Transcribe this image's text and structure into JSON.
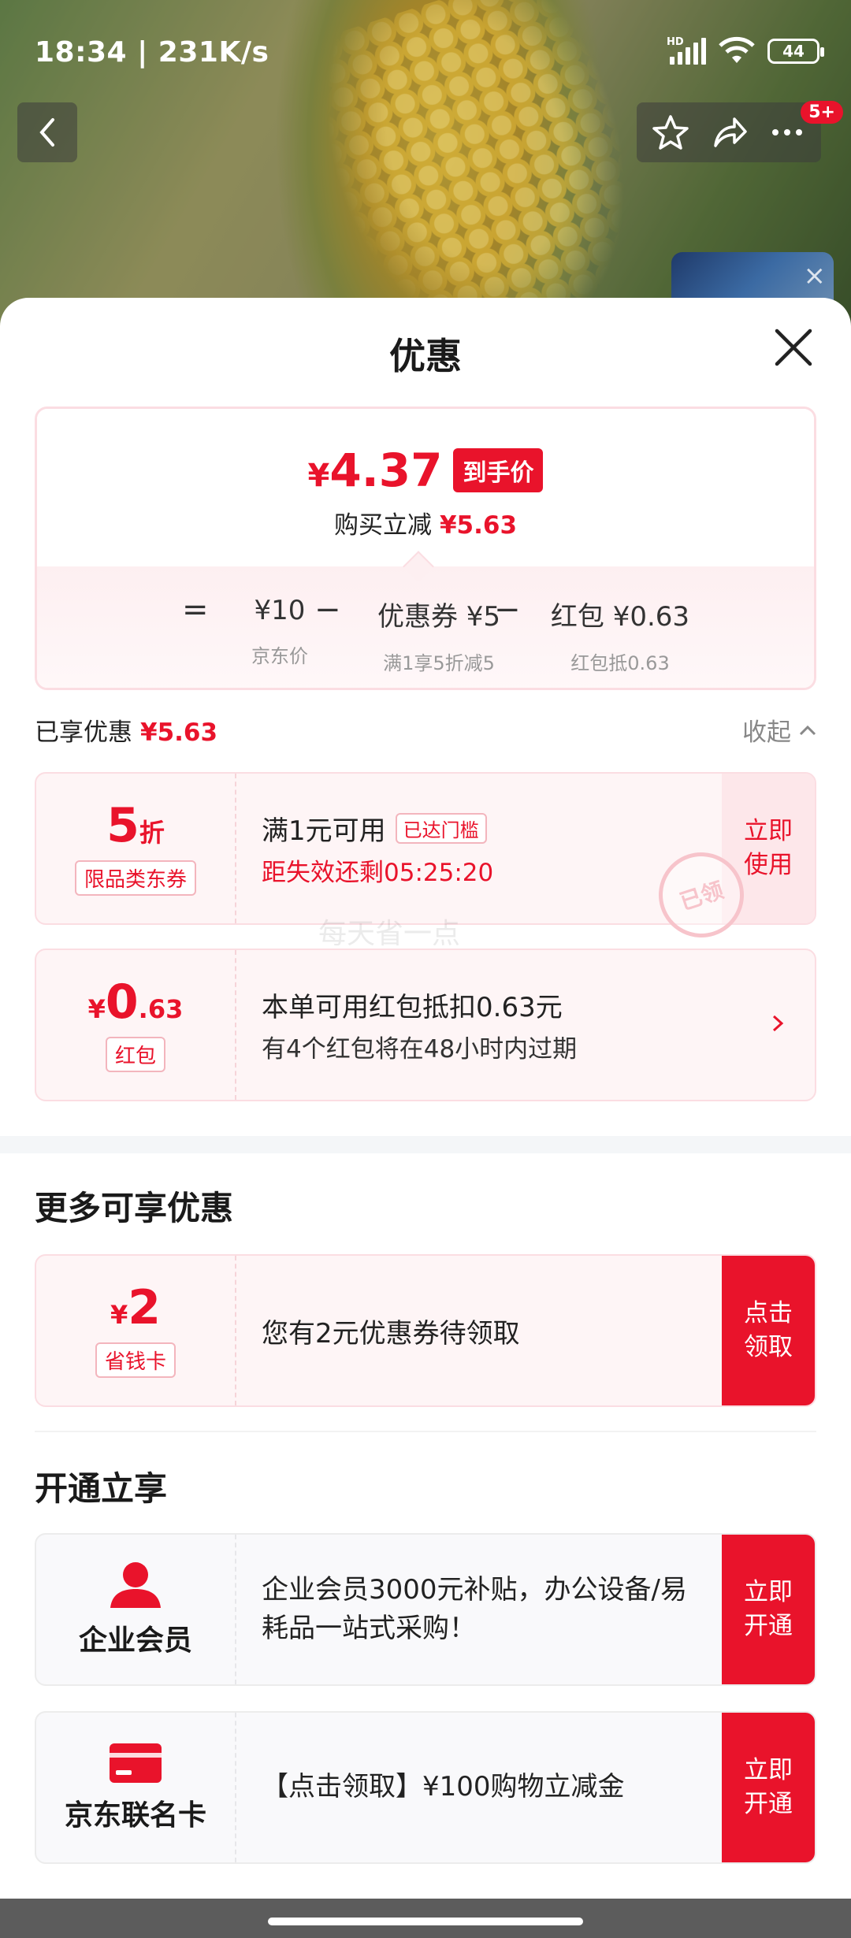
{
  "status_bar": {
    "time": "18:34 | 231K/s",
    "network": "HD",
    "battery": "44"
  },
  "nav": {
    "badge": "5+"
  },
  "sheet": {
    "title": "优惠",
    "price_card": {
      "final_price": "4.37",
      "currency": "¥",
      "final_tag": "到手价",
      "discount_text": "购买立减",
      "discount_value": "¥5.63",
      "formula": {
        "equals": "=",
        "minus": "−",
        "items": [
          {
            "value": "¥10",
            "label": "京东价"
          },
          {
            "value": "优惠券 ¥5",
            "label": "满1享5折减5"
          },
          {
            "value": "红包 ¥0.63",
            "label": "红包抵0.63"
          }
        ]
      }
    },
    "savings": {
      "label": "已享优惠",
      "value": "¥5.63",
      "toggle": "收起"
    },
    "coupon_discount": {
      "amount": "5",
      "unit": "折",
      "label": "限品类东券",
      "title": "满1元可用",
      "chip": "已达门槛",
      "countdown": "距失效还剩05:25:20",
      "action": "立即使用",
      "stamp": "已领"
    },
    "watermark": "每天省一点",
    "red_packet": {
      "currency": "¥",
      "amount_int": "0",
      "amount_dec": ".63",
      "label": "红包",
      "title": "本单可用红包抵扣0.63元",
      "subtitle": "有4个红包将在48小时内过期"
    },
    "more_section": {
      "title": "更多可享优惠",
      "card": {
        "currency": "¥",
        "amount": "2",
        "label": "省钱卡",
        "text": "您有2元优惠券待领取",
        "action": "点击领取"
      }
    },
    "open_section": {
      "title": "开通立享",
      "cards": [
        {
          "name": "企业会员",
          "icon": "person-icon",
          "text": "企业会员3000元补贴，办公设备/易耗品一站式采购！",
          "action": "立即开通"
        },
        {
          "name": "京东联名卡",
          "icon": "credit-card-icon",
          "text": "【点击领取】¥100购物立减金",
          "action": "立即开通"
        }
      ]
    }
  },
  "colors": {
    "accent": "#e9132b",
    "accent_soft": "#fef5f6",
    "border_soft": "#fbdde2"
  }
}
